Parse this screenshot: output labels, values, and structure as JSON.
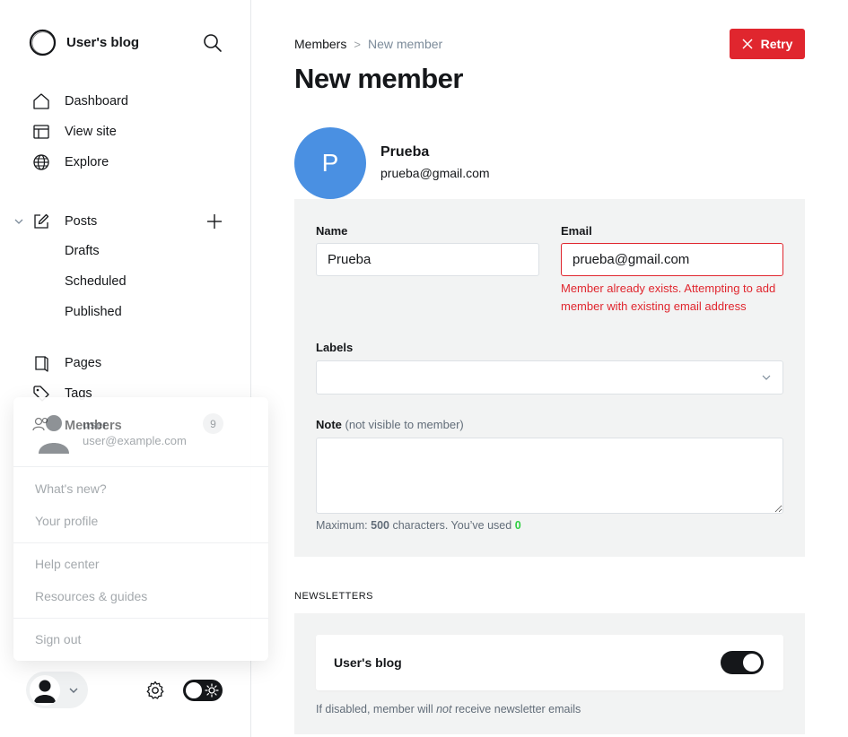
{
  "sidebar": {
    "brand_name": "User's blog",
    "nav": {
      "dashboard": "Dashboard",
      "view_site": "View site",
      "explore": "Explore",
      "posts": "Posts",
      "drafts": "Drafts",
      "scheduled": "Scheduled",
      "published": "Published",
      "pages": "Pages",
      "tags": "Tags",
      "members": "Members",
      "members_count": "9"
    },
    "user_menu": {
      "name": "user",
      "email": "user@example.com",
      "items": [
        "What's new?",
        "Your profile",
        "Help center",
        "Resources & guides",
        "Sign out"
      ]
    }
  },
  "header": {
    "breadcrumb_parent": "Members",
    "breadcrumb_separator": ">",
    "breadcrumb_current": "New member",
    "title": "New member",
    "retry_label": "Retry"
  },
  "member": {
    "initial": "P",
    "name": "Prueba",
    "email": "prueba@gmail.com"
  },
  "form": {
    "name_label": "Name",
    "name_value": "Prueba",
    "email_label": "Email",
    "email_value": "prueba@gmail.com",
    "email_error": "Member already exists. Attempting to add member with existing email address",
    "labels_label": "Labels",
    "note_label": "Note",
    "note_sublabel": "(not visible to member)",
    "note_value": "",
    "hint_prefix": "Maximum:",
    "hint_max": "500",
    "hint_middle": "characters. You’ve used",
    "hint_used": "0"
  },
  "newsletters": {
    "section_title": "NEWSLETTERS",
    "items": [
      {
        "name": "User's blog",
        "enabled": true
      }
    ],
    "hint_before": "If disabled, member will",
    "hint_em": "not",
    "hint_after": "receive newsletter emails"
  },
  "colors": {
    "accent_red": "#e0262e",
    "avatar_blue": "#4a90e2",
    "panel_gray": "#f2f3f3",
    "success_green": "#30cf43"
  }
}
